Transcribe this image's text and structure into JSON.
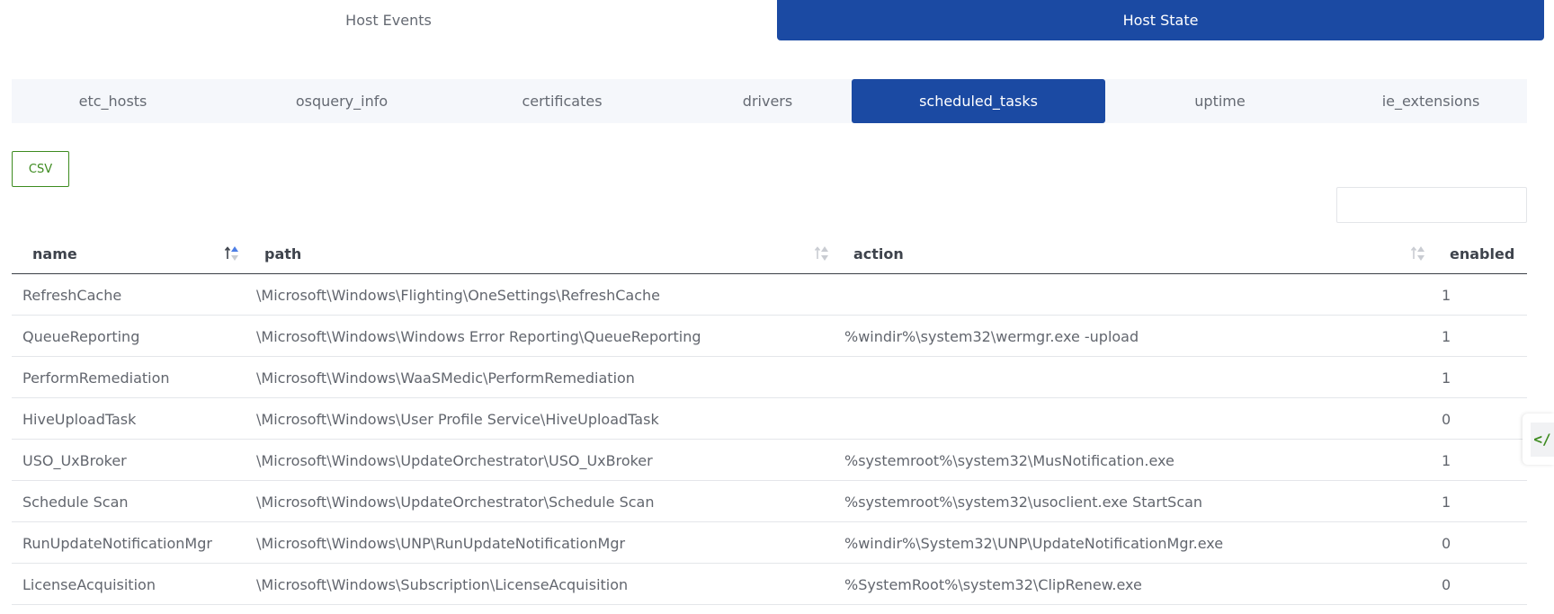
{
  "top_tabs": [
    {
      "label": "Host Events",
      "active": false
    },
    {
      "label": "Host State",
      "active": true
    }
  ],
  "sub_tabs": [
    {
      "label": "etc_hosts",
      "active": false
    },
    {
      "label": "osquery_info",
      "active": false
    },
    {
      "label": "certificates",
      "active": false
    },
    {
      "label": "drivers",
      "active": false
    },
    {
      "label": "scheduled_tasks",
      "active": true
    },
    {
      "label": "uptime",
      "active": false
    },
    {
      "label": "ie_extensions",
      "active": false
    }
  ],
  "csv_button": {
    "label": "CSV"
  },
  "search": {
    "value": "",
    "placeholder": ""
  },
  "table": {
    "columns": [
      {
        "label": "name",
        "sort": "ascending"
      },
      {
        "label": "path",
        "sort": "none"
      },
      {
        "label": "action",
        "sort": "none"
      },
      {
        "label": "enabled",
        "sort": "none"
      }
    ],
    "rows": [
      [
        "RefreshCache",
        "\\Microsoft\\Windows\\Flighting\\OneSettings\\RefreshCache",
        "",
        "1"
      ],
      [
        "QueueReporting",
        "\\Microsoft\\Windows\\Windows Error Reporting\\QueueReporting",
        "%windir%\\system32\\wermgr.exe -upload",
        "1"
      ],
      [
        "PerformRemediation",
        "\\Microsoft\\Windows\\WaaSMedic\\PerformRemediation",
        "",
        "1"
      ],
      [
        "HiveUploadTask",
        "\\Microsoft\\Windows\\User Profile Service\\HiveUploadTask",
        "",
        "0"
      ],
      [
        "USO_UxBroker",
        "\\Microsoft\\Windows\\UpdateOrchestrator\\USO_UxBroker",
        "%systemroot%\\system32\\MusNotification.exe",
        "1"
      ],
      [
        "Schedule Scan",
        "\\Microsoft\\Windows\\UpdateOrchestrator\\Schedule Scan",
        "%systemroot%\\system32\\usoclient.exe StartScan",
        "1"
      ],
      [
        "RunUpdateNotificationMgr",
        "\\Microsoft\\Windows\\UNP\\RunUpdateNotificationMgr",
        "%windir%\\System32\\UNP\\UpdateNotificationMgr.exe",
        "0"
      ],
      [
        "LicenseAcquisition",
        "\\Microsoft\\Windows\\Subscription\\LicenseAcquisition",
        "%SystemRoot%\\system32\\ClipRenew.exe",
        "0"
      ]
    ]
  },
  "side_tab": {
    "icon_text": "</",
    "icon": "code-icon"
  },
  "colors": {
    "primary": "#1b4aa3",
    "accent_green": "#3d8b1f",
    "sort_active": "#4d7ee6"
  }
}
